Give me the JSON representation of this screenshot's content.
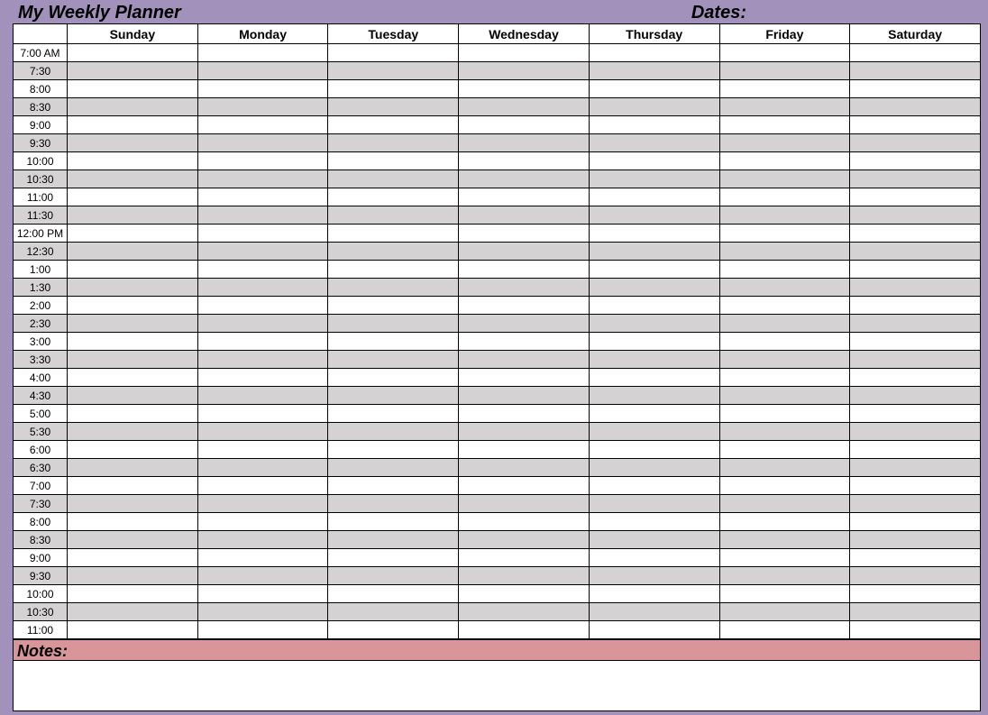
{
  "header": {
    "title": "My Weekly Planner",
    "dates_label": "Dates:"
  },
  "days": [
    "Sunday",
    "Monday",
    "Tuesday",
    "Wednesday",
    "Thursday",
    "Friday",
    "Saturday"
  ],
  "times": [
    "7:00 AM",
    "7:30",
    "8:00",
    "8:30",
    "9:00",
    "9:30",
    "10:00",
    "10:30",
    "11:00",
    "11:30",
    "12:00 PM",
    "12:30",
    "1:00",
    "1:30",
    "2:00",
    "2:30",
    "3:00",
    "3:30",
    "4:00",
    "4:30",
    "5:00",
    "5:30",
    "6:00",
    "6:30",
    "7:00",
    "7:30",
    "8:00",
    "8:30",
    "9:00",
    "9:30",
    "10:00",
    "10:30",
    "11:00"
  ],
  "notes": {
    "label": "Notes:",
    "content": ""
  }
}
